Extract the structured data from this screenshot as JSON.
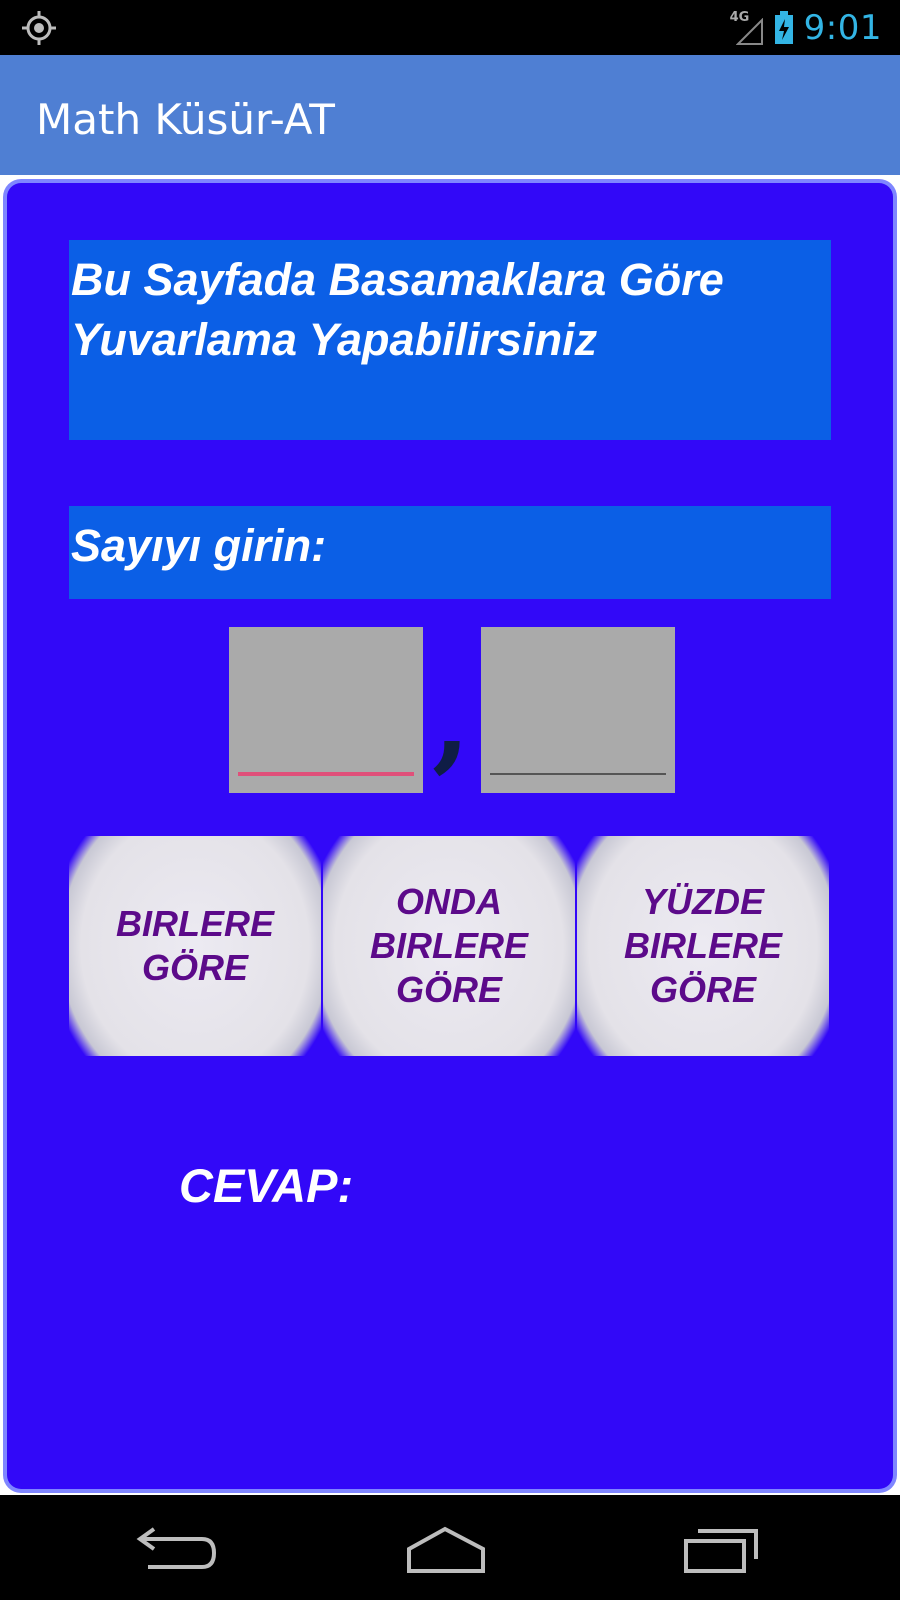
{
  "status_bar": {
    "left_icon": "gps-icon",
    "network_label": "4G",
    "signal_icon": "signal-icon",
    "battery_icon": "battery-charging-icon",
    "time": "9:01"
  },
  "action_bar": {
    "title": "Math Küsür-AT"
  },
  "content": {
    "intro": "Bu Sayfada Basamaklara Göre Yuvarlama Yapabilirsiniz",
    "prompt": "Sayıyı girin:",
    "inputs": {
      "integer_value": "",
      "decimal_value": "",
      "separator": ","
    },
    "buttons": [
      {
        "label": "BIRLERE\nGÖRE"
      },
      {
        "label": "ONDA\nBIRLERE\nGÖRE"
      },
      {
        "label": "YÜZDE\nBIRLERE\nGÖRE"
      }
    ],
    "answer_label": "CEVAP:"
  },
  "navigation": {
    "back_icon": "back-icon",
    "home_icon": "home-icon",
    "recent_apps_icon": "recent-apps-icon"
  },
  "colors": {
    "status_time": "#33b5e5",
    "action_bar": "#4f7fd3",
    "content_background": "#3208f8",
    "text_box_background": "#0b5fe6",
    "input_background": "#aaaaaa",
    "button_text": "#5c0a8a",
    "active_underline": "#e0507a"
  }
}
